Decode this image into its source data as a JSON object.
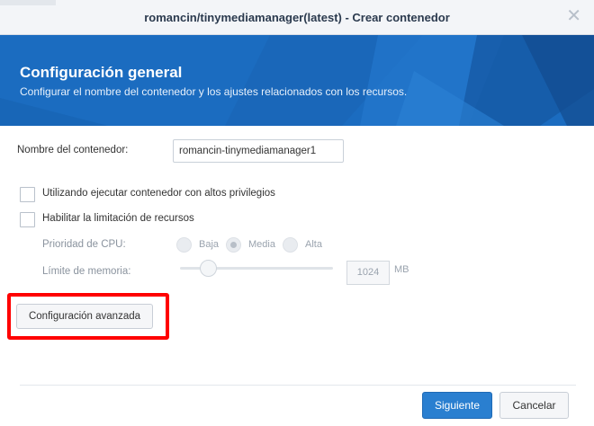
{
  "dialog": {
    "title": "romancin/tinymediamanager(latest) - Crear contenedor",
    "close_glyph": "✕"
  },
  "banner": {
    "title": "Configuración general",
    "subtitle": "Configurar el nombre del contenedor y los ajustes relacionados con los recursos."
  },
  "form": {
    "container_name_label": "Nombre del contenedor:",
    "container_name_value": "romancin-tinymediamanager1",
    "privileged_label": "Utilizando ejecutar contenedor con altos privilegios",
    "privileged_checked": false,
    "resource_limit_label": "Habilitar la limitación de recursos",
    "resource_limit_checked": false,
    "cpu_priority_label": "Prioridad de CPU:",
    "cpu_options": [
      "Baja",
      "Media",
      "Alta"
    ],
    "cpu_selected": "Media",
    "memory_limit_label": "Límite de memoria:",
    "memory_value": "1024",
    "memory_unit": "MB",
    "advanced_button": "Configuración avanzada"
  },
  "footer": {
    "next_button": "Siguiente",
    "cancel_button": "Cancelar"
  },
  "colors": {
    "banner": "#1c6fc4",
    "primary_button": "#2a7fd0",
    "highlight": "#ff0000"
  }
}
